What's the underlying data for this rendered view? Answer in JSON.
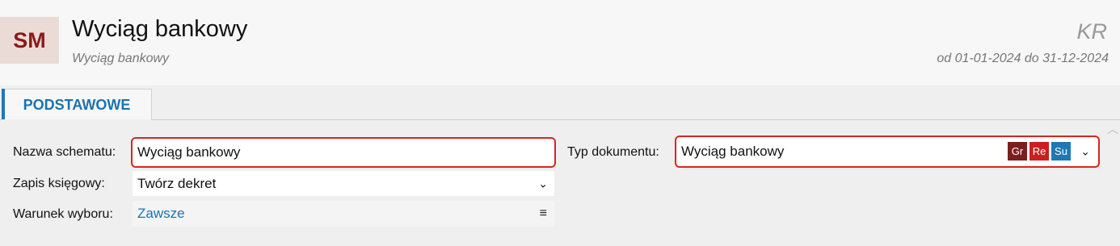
{
  "header": {
    "avatar_initials": "SM",
    "title": "Wyciąg bankowy",
    "subtitle": "Wyciąg bankowy",
    "code": "KR",
    "period": "od 01-01-2024 do 31-12-2024"
  },
  "tabs": [
    {
      "label": "PODSTAWOWE",
      "active": true
    }
  ],
  "form": {
    "nazwa_schematu": {
      "label": "Nazwa schematu:",
      "value": "Wyciąg bankowy"
    },
    "zapis_ksiegowy": {
      "label": "Zapis księgowy:",
      "value": "Twórz dekret",
      "arrow": "⌄"
    },
    "warunek_wyboru": {
      "label": "Warunek wyboru:",
      "value": "Zawsze",
      "menu": "≡"
    },
    "typ_dokumentu": {
      "label": "Typ dokumentu:",
      "value": "Wyciąg bankowy",
      "buttons": [
        {
          "label": "Gr",
          "color": "#7a1f1f"
        },
        {
          "label": "Re",
          "color": "#cc1f1f"
        },
        {
          "label": "Su",
          "color": "#1f78b4"
        }
      ],
      "arrow": "⌄"
    }
  },
  "icons": {
    "scroll_up": "︿"
  }
}
